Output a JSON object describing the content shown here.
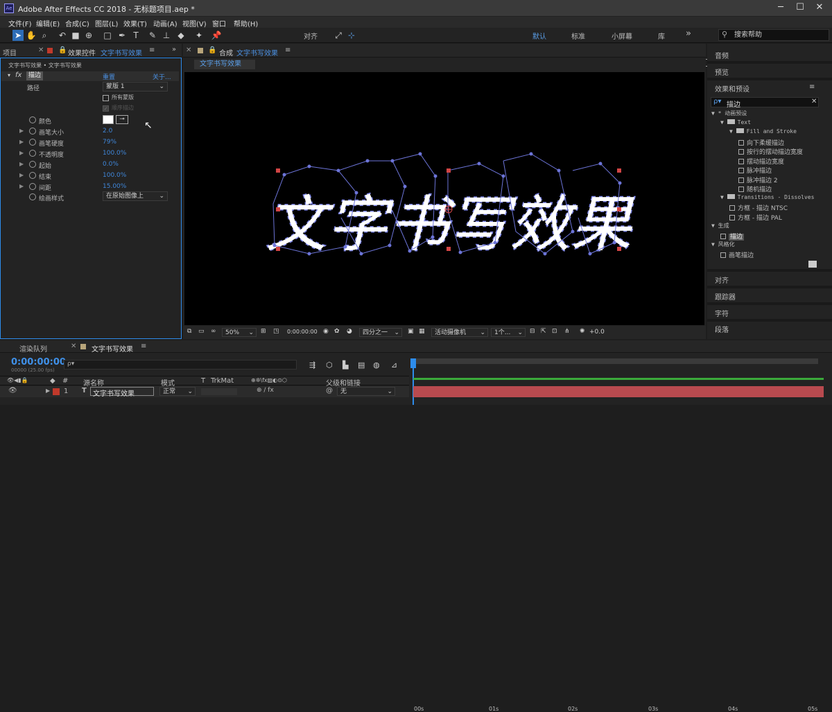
{
  "window": {
    "title": "Adobe After Effects CC 2018 - 无标题项目.aep *",
    "app_icon": "Ae",
    "minimize": "─",
    "maximize": "☐",
    "close": "✕"
  },
  "menu": [
    "文件(F)",
    "编辑(E)",
    "合成(C)",
    "图层(L)",
    "效果(T)",
    "动画(A)",
    "视图(V)",
    "窗口",
    "帮助(H)"
  ],
  "toolbar": {
    "snap_label": "对齐",
    "workspaces": [
      "默认",
      "标准",
      "小屏幕",
      "库"
    ],
    "active_workspace": "默认",
    "more": "»",
    "search_placeholder": "搜索帮助"
  },
  "left_panel": {
    "project_tab": "项目",
    "effects_tab_prefix": "效果控件",
    "effects_tab_target": "文字书写效果",
    "breadcrumb": "文字书写效果 • 文字书写效果",
    "fx_label": "fx",
    "effect_name": "描边",
    "reset": "重置",
    "about": "关于...",
    "path_label": "路径",
    "path_value": "蒙版 1",
    "all_masks": "所有蒙版",
    "sequential": "顺序描边",
    "color_label": "颜色",
    "properties": [
      {
        "name": "画笔大小",
        "value": "2.0"
      },
      {
        "name": "画笔硬度",
        "value": "79%"
      },
      {
        "name": "不透明度",
        "value": "100.0%"
      },
      {
        "name": "起始",
        "value": "0.0%"
      },
      {
        "name": "结束",
        "value": "100.0%"
      },
      {
        "name": "间距",
        "value": "15.00%"
      }
    ],
    "paint_style_label": "绘画样式",
    "paint_style_value": "在原始图像上"
  },
  "composition": {
    "tab_prefix": "合成",
    "tab_name": "文字书写效果",
    "subtab": "文字书写效果",
    "canvas_text": "文字书写效果",
    "bottom_bar": {
      "zoom": "50%",
      "timecode": "0:00:00:00",
      "resolution": "四分之一",
      "camera": "活动摄像机",
      "views": "1个...",
      "exposure": "+0.0"
    }
  },
  "right_panel": {
    "audio": "音频",
    "preview": "预览",
    "effects_presets_title": "效果和预设",
    "search_value": "描边",
    "tree": [
      {
        "label": "* 动画预设",
        "depth": 0,
        "kind": "group"
      },
      {
        "label": "Text",
        "depth": 1,
        "kind": "folder"
      },
      {
        "label": "Fill and Stroke",
        "depth": 2,
        "kind": "folder"
      },
      {
        "label": "向下柔缓描边",
        "depth": 3,
        "kind": "preset"
      },
      {
        "label": "按行的摆动描边宽度",
        "depth": 3,
        "kind": "preset"
      },
      {
        "label": "摆动描边宽度",
        "depth": 3,
        "kind": "preset"
      },
      {
        "label": "脉冲描边",
        "depth": 3,
        "kind": "preset"
      },
      {
        "label": "脉冲描边 2",
        "depth": 3,
        "kind": "preset"
      },
      {
        "label": "随机描边",
        "depth": 3,
        "kind": "preset"
      },
      {
        "label": "Transitions - Dissolves",
        "depth": 1,
        "kind": "folder"
      },
      {
        "label": "方框 - 描边 NTSC",
        "depth": 2,
        "kind": "preset"
      },
      {
        "label": "方框 - 描边 PAL",
        "depth": 2,
        "kind": "preset"
      },
      {
        "label": "生成",
        "depth": 0,
        "kind": "group"
      },
      {
        "label": "描边",
        "depth": 1,
        "kind": "effect",
        "selected": true
      },
      {
        "label": "风格化",
        "depth": 0,
        "kind": "group"
      },
      {
        "label": "画笔描边",
        "depth": 1,
        "kind": "effect"
      }
    ],
    "align": "对齐",
    "tracker": "跟踪器",
    "character": "字符",
    "paragraph": "段落"
  },
  "timeline": {
    "render_queue_tab": "渲染队列",
    "comp_tab": "文字书写效果",
    "timecode": "0:00:00:00",
    "fps": "00000 (25.00 fps)",
    "search_placeholder": "ρ▾",
    "columns": {
      "source_name": "源名称",
      "mode": "模式",
      "t": "T",
      "trkmat": "TrkMat",
      "parent": "父级和链接"
    },
    "ruler": [
      "00s",
      "01s",
      "02s",
      "03s",
      "04s",
      "05s"
    ],
    "layer": {
      "index": "1",
      "type": "T",
      "name": "文字书写效果",
      "mode": "正常",
      "parent": "无"
    }
  },
  "colors": {
    "accent_blue": "#2d8ceb",
    "layer_red": "#c0392b",
    "layer_bar": "#b84a4f",
    "handle": "#d24545",
    "path": "#6c74d8"
  }
}
